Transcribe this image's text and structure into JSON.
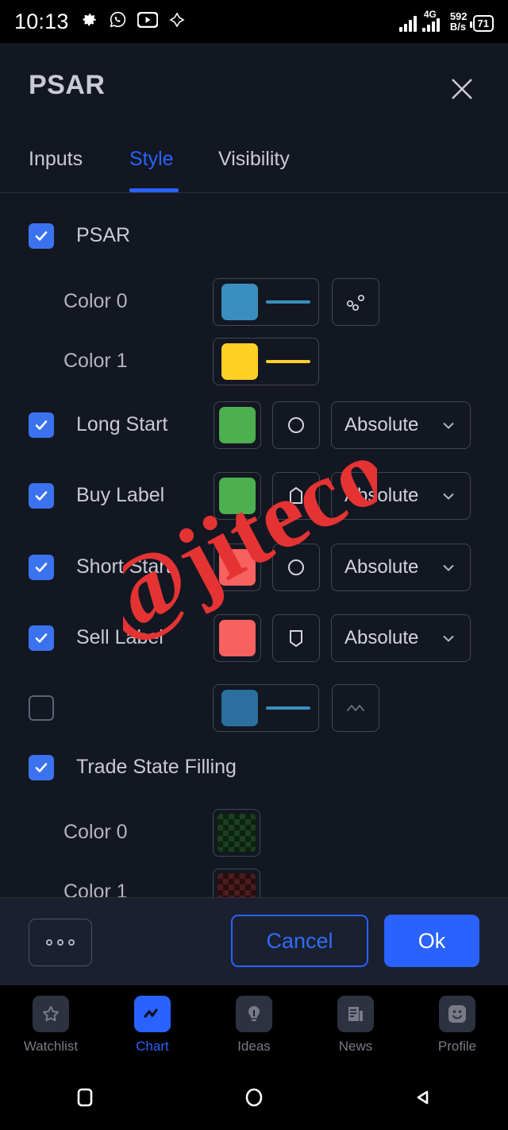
{
  "statusbar": {
    "time": "10:13",
    "icons": [
      "gear-icon",
      "whatsapp-icon",
      "youtube-icon",
      "diamond-icon"
    ],
    "network_type": "4G",
    "data_speed_value": "592",
    "data_speed_unit": "B/s",
    "battery_level": "71"
  },
  "dialog": {
    "title": "PSAR",
    "close_label": "close-icon",
    "tabs": [
      {
        "label": "Inputs",
        "active": false
      },
      {
        "label": "Style",
        "active": true
      },
      {
        "label": "Visibility",
        "active": false
      }
    ],
    "rows": [
      {
        "label": "PSAR",
        "checkbox": "checked"
      },
      {
        "label": "Color 0",
        "indent": true,
        "swatch": "#3a8ec0",
        "line": "#3a8ec0",
        "icon": "scatter-dots-icon"
      },
      {
        "label": "Color 1",
        "indent": true,
        "swatch": "#ffd025",
        "line": "#ffd025"
      },
      {
        "label": "Long Start",
        "checkbox": "checked",
        "swatch": "#4caf50",
        "icon": "circle-icon",
        "select": "Absolute"
      },
      {
        "label": "Buy Label",
        "checkbox": "checked",
        "swatch": "#4caf50",
        "icon": "label-up-icon",
        "select": "Absolute"
      },
      {
        "label": "Short Start",
        "checkbox": "checked",
        "swatch": "#f7615f",
        "icon": "circle-icon",
        "select": "Absolute"
      },
      {
        "label": "Sell Label",
        "checkbox": "checked",
        "swatch": "#f7615f",
        "icon": "label-down-icon",
        "select": "Absolute"
      },
      {
        "label": "",
        "checkbox": "unchecked",
        "swatch": "#2a6f9e",
        "line": "#3a8ec0",
        "icon": "wave-line-icon"
      },
      {
        "label": "Trade State Filling",
        "checkbox": "checked"
      },
      {
        "label": "Color 0",
        "indent": true,
        "fill": "transparent-green"
      },
      {
        "label": "Color 1",
        "indent": true,
        "fill": "transparent-red"
      }
    ]
  },
  "footer": {
    "more_label": "more-options-icon",
    "cancel_label": "Cancel",
    "ok_label": "Ok"
  },
  "bottomnav": [
    {
      "label": "Watchlist",
      "icon": "star-icon",
      "active": false
    },
    {
      "label": "Chart",
      "icon": "chart-line-icon",
      "active": true
    },
    {
      "label": "Ideas",
      "icon": "lightbulb-icon",
      "active": false
    },
    {
      "label": "News",
      "icon": "news-document-icon",
      "active": false
    },
    {
      "label": "Profile",
      "icon": "smiley-face-icon",
      "active": false
    }
  ],
  "androidnav": [
    {
      "label": "recents-square-icon"
    },
    {
      "label": "home-circle-icon"
    },
    {
      "label": "back-triangle-icon"
    }
  ],
  "watermark": {
    "text": "@jiteco",
    "color": "#e53333"
  },
  "colors": {
    "accent_blue": "#2962ff",
    "checkbox_blue": "#3b72ef",
    "panel_bg": "#131722",
    "footer_bg": "#1b2030",
    "border": "#434651",
    "text": "#c8cbd3"
  }
}
